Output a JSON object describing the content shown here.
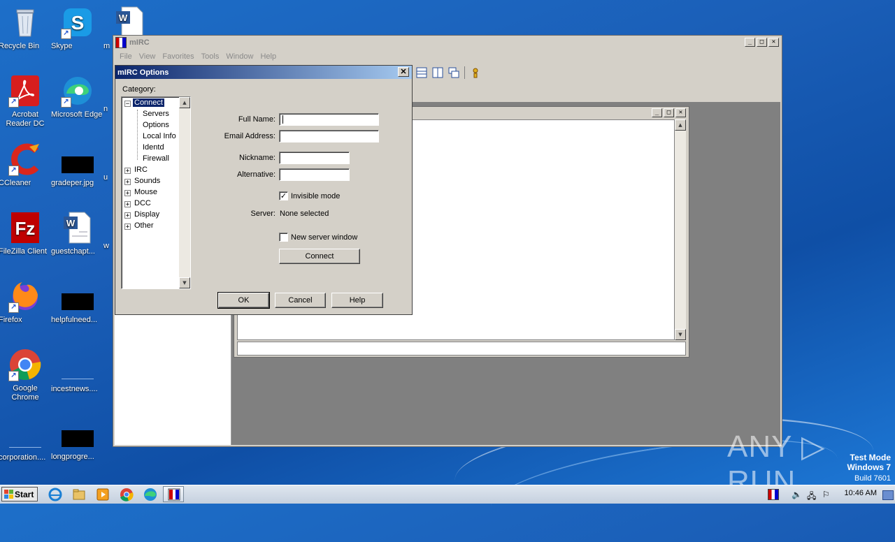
{
  "desktop": {
    "icons": [
      {
        "label": "Recycle Bin"
      },
      {
        "label": "Skype"
      },
      {
        "label": "m"
      },
      {
        "label": "Acrobat Reader DC"
      },
      {
        "label": "Microsoft Edge"
      },
      {
        "label": "n"
      },
      {
        "label": "CCleaner"
      },
      {
        "label": "gradeper.jpg"
      },
      {
        "label": "u"
      },
      {
        "label": "FileZilla Client"
      },
      {
        "label": "guestchapt..."
      },
      {
        "label": "w"
      },
      {
        "label": "Firefox"
      },
      {
        "label": "helpfulneed..."
      },
      {
        "label": "Google Chrome"
      },
      {
        "label": "incestnews...."
      },
      {
        "label": "corporation...."
      },
      {
        "label": "longprogre..."
      }
    ]
  },
  "mirc": {
    "title": "mIRC",
    "menu": [
      "File",
      "View",
      "Favorites",
      "Tools",
      "Window",
      "Help"
    ]
  },
  "dialog": {
    "title": "mIRC Options",
    "category_label": "Category:",
    "tree": {
      "connect": "Connect",
      "connect_children": [
        "Servers",
        "Options",
        "Local Info",
        "Identd",
        "Firewall"
      ],
      "others": [
        "IRC",
        "Sounds",
        "Mouse",
        "DCC",
        "Display",
        "Other"
      ]
    },
    "fields": {
      "full_name_label": "Full Name:",
      "full_name_value": "",
      "email_label": "Email Address:",
      "email_value": "",
      "nickname_label": "Nickname:",
      "nickname_value": "",
      "alternative_label": "Alternative:",
      "alternative_value": ""
    },
    "invisible_mode_label": "Invisible mode",
    "invisible_mode_checked": true,
    "server_label": "Server:",
    "server_value": "None selected",
    "new_server_window_label": "New server window",
    "new_server_window_checked": false,
    "connect_button": "Connect",
    "ok_button": "OK",
    "cancel_button": "Cancel",
    "help_button": "Help"
  },
  "taskbar": {
    "start_label": "Start",
    "clock": "10:46 AM"
  },
  "watermark": {
    "brand": "ANY ▷ RUN",
    "mode_line1": "Test Mode",
    "mode_line2": "Windows 7",
    "mode_line3": "Build 7601"
  }
}
